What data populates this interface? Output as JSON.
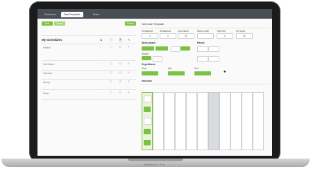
{
  "tabs": [
    "Dashboard",
    "Data Templates",
    "Notes"
  ],
  "left_panel": {
    "buttons": [
      "New",
      "Import",
      "Export"
    ],
    "title": "My Schedules",
    "rows": [
      "Default",
      "Fall Sched",
      "Intensive",
      "Spring",
      "Relax"
    ]
  },
  "right_panel": {
    "header": "Schedule Template",
    "field_labels": [
      "Resistance",
      "Resistance",
      "Cool down",
      "Warm cycle",
      "Time left",
      "Set cycle"
    ],
    "field_values": [
      "0",
      "0",
      "00",
      "",
      "0",
      "00"
    ],
    "section_a": "Work phase",
    "section_b": "Pause",
    "section_c": "Repetitions",
    "section_d": "Intervals",
    "weights": [
      "Weight",
      "Weight"
    ],
    "cycle_labels": [
      "Start",
      "Mid",
      "End"
    ]
  },
  "device_brand": "MacBook Pro",
  "colors": {
    "accent": "#7cc242",
    "topbar": "#4a4e55"
  }
}
